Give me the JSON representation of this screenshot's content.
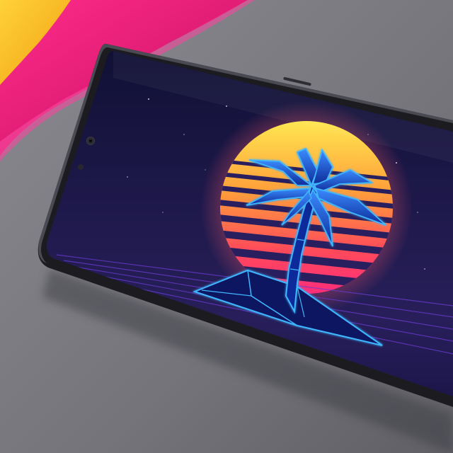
{
  "scene": {
    "subject": "smartphone-with-retro-palm-wallpaper",
    "colors": {
      "table": "#7a7a80",
      "table_dark": "#55555a",
      "phone_body": "#1c1c20",
      "screen_sky_top": "#14143a",
      "screen_sky_bottom": "#2a1f5e",
      "sun_top": "#ffe24a",
      "sun_mid": "#ff7a3a",
      "sun_bottom": "#ff2d6e",
      "neon_blue": "#3fb6ff",
      "neon_blue_dark": "#0b2a8a",
      "notebook_pink": "#e8177a",
      "notebook_yellow": "#f7b718"
    },
    "icons": [
      "notch-camera-icon",
      "palm-tree-icon",
      "island-icon",
      "sun-icon"
    ]
  }
}
